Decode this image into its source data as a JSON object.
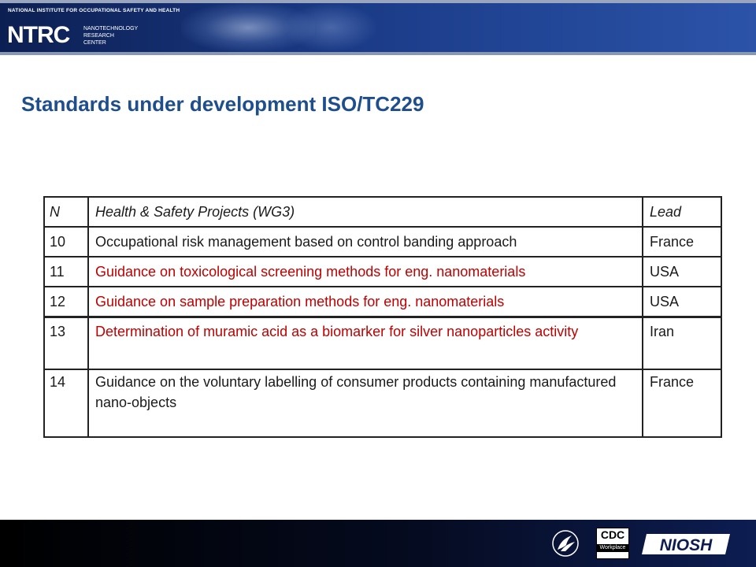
{
  "header": {
    "institute": "NATIONAL INSTITUTE FOR OCCUPATIONAL SAFETY AND HEALTH",
    "logo_main": "NTRC",
    "logo_sub": "NANOTECHNOLOGY\nRESEARCH\nCENTER"
  },
  "title": "Standards under development ISO/TC229",
  "table": {
    "headers": {
      "n": "N",
      "project": "Health & Safety Projects (WG3)",
      "lead": "Lead"
    },
    "rows": [
      {
        "n": "10",
        "project": "Occupational risk management based on control banding approach",
        "lead": "France",
        "highlight": false
      },
      {
        "n": "11",
        "project": "Guidance on toxicological screening methods for eng. nanomaterials",
        "lead": "USA",
        "highlight": true
      },
      {
        "n": "12",
        "project": "Guidance on sample preparation methods for eng. nanomaterials",
        "lead": "USA",
        "highlight": true
      },
      {
        "n": "13",
        "project": "Determination of muramic acid as a biomarker for silver nanoparticles activity",
        "lead": "Iran",
        "highlight": true
      },
      {
        "n": "14",
        "project": "Guidance on the voluntary labelling of consumer products containing manufactured nano-objects",
        "lead": "France",
        "highlight": false
      }
    ],
    "highlight_color": "#c00000"
  },
  "footer": {
    "cdc_logo_text": "CDC",
    "cdc_logo_sub": "Workplace",
    "niosh_logo_text": "NIOSH",
    "icons": [
      "hhs-eagle-icon",
      "cdc-logo",
      "niosh-logo"
    ]
  },
  "colors": {
    "title": "#1f4e8d",
    "header_bg": "#1a3a86",
    "footer_bg": "#000000"
  }
}
